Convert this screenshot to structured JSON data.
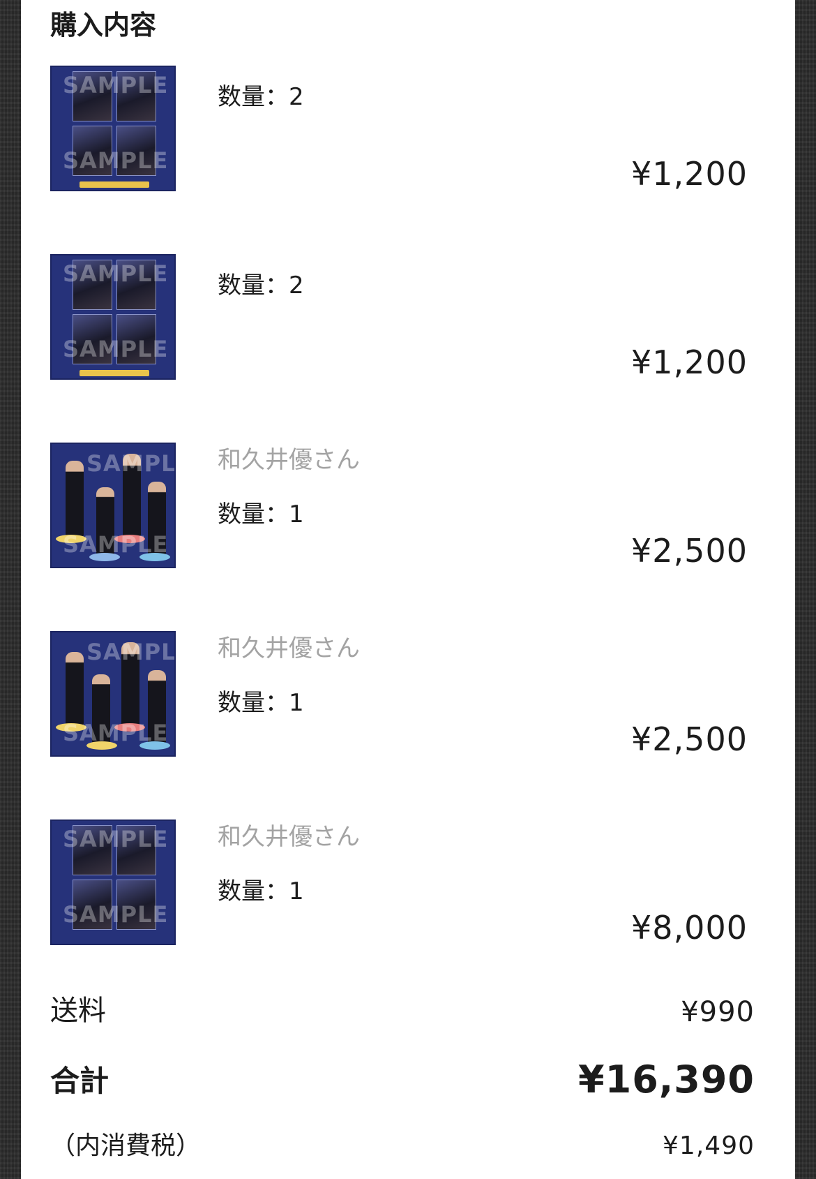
{
  "section": {
    "title": "購入内容"
  },
  "items": [
    {
      "name": "",
      "quantity_text": "数量：2",
      "price": "¥1,200",
      "thumbnail": {
        "style": "photo-grid",
        "watermark": "SAMPLE"
      }
    },
    {
      "name": "",
      "quantity_text": "数量：2",
      "price": "¥1,200",
      "thumbnail": {
        "style": "photo-grid",
        "watermark": "SAMPLE"
      }
    },
    {
      "name": "和久井優さん",
      "quantity_text": "数量：1",
      "price": "¥2,500",
      "thumbnail": {
        "style": "acrylic-stands",
        "watermark": "SAMPLE"
      }
    },
    {
      "name": "和久井優さん",
      "quantity_text": "数量：1",
      "price": "¥2,500",
      "thumbnail": {
        "style": "acrylic-stands",
        "watermark": "SAMPLE"
      }
    },
    {
      "name": "和久井優さん",
      "quantity_text": "数量：1",
      "price": "¥8,000",
      "thumbnail": {
        "style": "photo-grid",
        "watermark": "SAMPLE"
      }
    }
  ],
  "summary": {
    "shipping_label": "送料",
    "shipping_value": "¥990",
    "total_label": "合計",
    "total_value": "¥16,390",
    "tax_label": "（内消費税）",
    "tax_value": "¥1,490"
  },
  "colors": {
    "thumbnail_bg": "#26327a",
    "item_name": "#a3a3a3",
    "text": "#1c1c1c",
    "page_bg": "#2c2c2c"
  }
}
